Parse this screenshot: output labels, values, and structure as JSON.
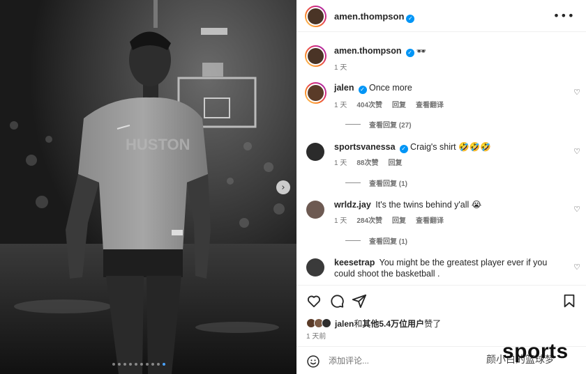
{
  "post": {
    "author": "amen.thompson",
    "more_icon": "more-horizontal-icon",
    "carousel_next_icon": "chevron-right-icon",
    "carousel_dots": 10,
    "carousel_active_index": 9
  },
  "caption": {
    "username": "amen.thompson",
    "emoji": "🕶",
    "time": "1 天"
  },
  "comments": [
    {
      "username": "jalen",
      "verified": true,
      "text": "Once more",
      "time": "1 天",
      "likes": "404次赞",
      "reply": "回复",
      "translate": "查看翻译",
      "view_replies": "查看回复 (27)",
      "avatar_color": "#5a3b28"
    },
    {
      "username": "sportsvanessa",
      "verified": true,
      "text": "Craig's shirt 🤣🤣🤣",
      "time": "1 天",
      "likes": "88次赞",
      "reply": "回复",
      "translate": "",
      "view_replies": "查看回复 (1)",
      "avatar_color": "#2b2b2b"
    },
    {
      "username": "wrldz.jay",
      "verified": false,
      "text": "It's the twins behind y'all 😭",
      "time": "1 天",
      "likes": "284次赞",
      "reply": "回复",
      "translate": "查看翻译",
      "view_replies": "查看回复 (1)",
      "avatar_color": "#6d5a52"
    },
    {
      "username": "keesetrap",
      "verified": false,
      "text": "You might be the greatest player ever if you could shoot the basketball .",
      "time": "",
      "likes": "",
      "reply": "",
      "translate": "",
      "view_replies": "",
      "avatar_color": "#3a3a3a"
    }
  ],
  "actions": {
    "like_icon": "heart-icon",
    "comment_icon": "comment-icon",
    "share_icon": "send-icon",
    "save_icon": "bookmark-icon"
  },
  "likes_summary": {
    "first_user": "jalen",
    "connector": "和",
    "others": "其他5.4万位用户",
    "suffix": "赞了"
  },
  "post_time": "1 天前",
  "add_comment": {
    "placeholder": "添加评论...",
    "emoji_icon": "smile-icon"
  },
  "watermark": {
    "main": "sports",
    "sub": "颜小白的篮球梦"
  },
  "colors": {
    "accent": "#0095f6",
    "muted_text": "#737373",
    "divider": "#efefef"
  }
}
